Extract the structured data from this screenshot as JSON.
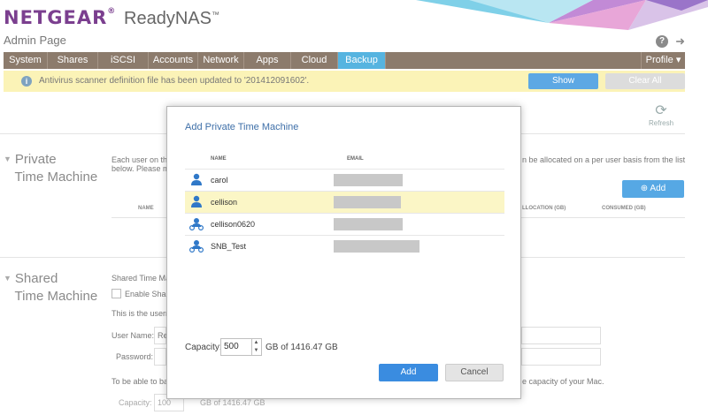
{
  "brand": {
    "name": "NETGEAR",
    "reg": "®",
    "product": "ReadyNAS",
    "tm": "™",
    "subtitle": "Admin Page"
  },
  "nav": {
    "tabs": [
      "System",
      "Shares",
      "iSCSI",
      "Accounts",
      "Network",
      "Apps",
      "Cloud",
      "Backup"
    ],
    "active": "Backup",
    "profile": "Profile ▾"
  },
  "alert": {
    "message": "Antivirus scanner definition file has been updated to '201412091602'.",
    "show_label": "Show",
    "clear_label": "Clear All"
  },
  "toolbar": {
    "refresh_label": "Refresh"
  },
  "private_section": {
    "title_line1": "Private",
    "title_line2": "Time Machine",
    "desc_left_line1": "Each user on the",
    "desc_left_line2": "below. Please m",
    "desc_right": "n be allocated on a per user basis from the list",
    "add_label": "Add",
    "col_name": "NAME",
    "col_allocation": "LLOCATION (GB)",
    "col_consumed": "CONSUMED (GB)"
  },
  "shared_section": {
    "title_line1": "Shared",
    "title_line2": "Time Machine",
    "desc": "Shared Time Ma",
    "enable_label": "Enable Shar",
    "info": "This is the usern",
    "username_label": "User Name:",
    "username_value": "Re",
    "password_label": "Password:",
    "backup_left": "To be able to ba",
    "backup_right": "e capacity of your Mac.",
    "capacity_label": "Capacity:",
    "capacity_value": "100",
    "capacity_total": "GB of 1416.47 GB"
  },
  "modal": {
    "title": "Add Private Time Machine",
    "col_name": "NAME",
    "col_email": "EMAIL",
    "users": [
      {
        "name": "carol",
        "icon": "user-icon"
      },
      {
        "name": "cellison",
        "icon": "user-icon"
      },
      {
        "name": "cellison0620",
        "icon": "group-user-icon"
      },
      {
        "name": "SNB_Test",
        "icon": "group-user-icon"
      }
    ],
    "selected_user": "cellison",
    "capacity_label": "Capacity:",
    "capacity_value": "500",
    "capacity_total": "GB of 1416.47 GB",
    "add_label": "Add",
    "cancel_label": "Cancel"
  },
  "colors": {
    "brand": "#7b3f8f",
    "nav": "#8c7b6c",
    "active_tab": "#56b4e0",
    "primary_button": "#3a8ce0",
    "alert_bg": "#fbf3b7"
  }
}
